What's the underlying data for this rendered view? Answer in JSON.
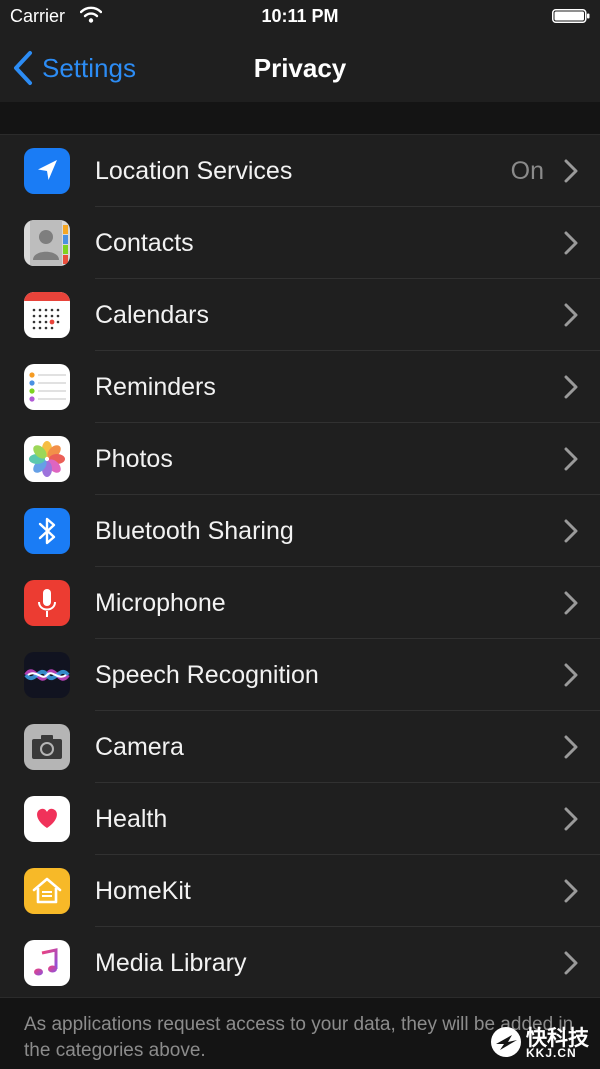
{
  "status_bar": {
    "carrier": "Carrier",
    "time": "10:11 PM"
  },
  "nav": {
    "back_label": "Settings",
    "title": "Privacy"
  },
  "items": [
    {
      "label": "Location Services",
      "value": "On",
      "icon": "location-arrow-icon"
    },
    {
      "label": "Contacts",
      "value": "",
      "icon": "contacts-icon"
    },
    {
      "label": "Calendars",
      "value": "",
      "icon": "calendar-icon"
    },
    {
      "label": "Reminders",
      "value": "",
      "icon": "reminders-icon"
    },
    {
      "label": "Photos",
      "value": "",
      "icon": "photos-icon"
    },
    {
      "label": "Bluetooth Sharing",
      "value": "",
      "icon": "bluetooth-icon"
    },
    {
      "label": "Microphone",
      "value": "",
      "icon": "microphone-icon"
    },
    {
      "label": "Speech Recognition",
      "value": "",
      "icon": "siri-icon"
    },
    {
      "label": "Camera",
      "value": "",
      "icon": "camera-icon"
    },
    {
      "label": "Health",
      "value": "",
      "icon": "heart-icon"
    },
    {
      "label": "HomeKit",
      "value": "",
      "icon": "home-icon"
    },
    {
      "label": "Media Library",
      "value": "",
      "icon": "music-note-icon"
    }
  ],
  "footer": {
    "note": "As applications request access to your data, they will be added in the categories above."
  },
  "watermark": {
    "text": "快科技",
    "sub": "KKJ.CN"
  },
  "colors": {
    "accent": "#2c8cf4",
    "background": "#141414",
    "cell": "#1f1f1f"
  }
}
